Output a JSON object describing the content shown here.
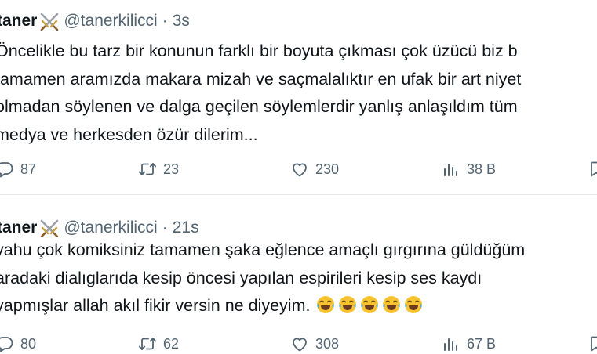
{
  "tweets": [
    {
      "author_name": "taner",
      "handle": "@tanerkilicci",
      "separator": "·",
      "time": "3s",
      "lines": [
        "Öncelikle bu tarz bir konunun   farklı bir boyuta çıkması çok üzücü biz b",
        "tamamen aramızda makara mizah ve saçmalalıktır en ufak bir art niyet",
        "olmadan söylenen ve dalga geçilen söylemlerdir yanlış anlaşıldım tüm",
        "medya ve herkesden  özür dilerim..."
      ],
      "replies": "87",
      "retweets": "23",
      "likes": "230",
      "views": "38 B"
    },
    {
      "author_name": "taner",
      "handle": "@tanerkilicci",
      "separator": "·",
      "time": "21s",
      "lines": [
        "yahu çok komiksiniz tamamen şaka eğlence  amaçlı gırgırına güldüğüm",
        "aradaki dialıglarıda   kesip öncesi yapılan espirileri kesip ses kaydı",
        "yapmışlar allah akıl fikir versin ne diyeyim."
      ],
      "emojis": [
        "face-with-tears-of-joy",
        "face-with-tears-of-joy",
        "face-with-tears-of-joy",
        "face-with-tears-of-joy",
        "face-with-tears-of-joy"
      ],
      "replies": "80",
      "retweets": "62",
      "likes": "308",
      "views": "67 B"
    }
  ],
  "icons": {
    "name_badge": "crossed-swords-icon",
    "reply": "reply-icon",
    "retweet": "retweet-icon",
    "like": "heart-icon",
    "views": "views-icon",
    "bookmark": "bookmark-icon"
  },
  "colors": {
    "text": "#0f1419",
    "secondary": "#536471",
    "divider": "#e6e9eb"
  }
}
